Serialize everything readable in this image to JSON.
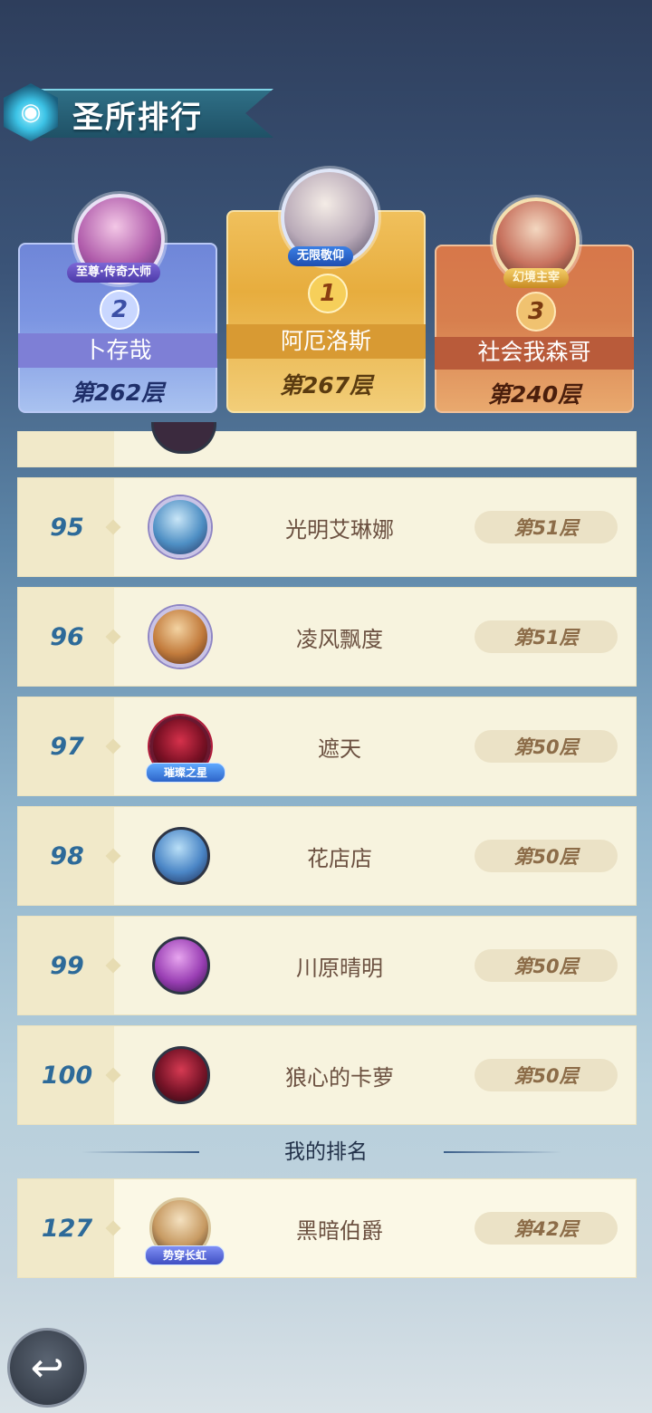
{
  "header": {
    "title": "圣所排行",
    "icon": "sanctuary-emblem-icon"
  },
  "podium": [
    {
      "rank": "2",
      "name": "卜存哉",
      "floor": "第262层",
      "title": "至尊·传奇大师"
    },
    {
      "rank": "1",
      "name": "阿厄洛斯",
      "floor": "第267层",
      "title": "无限敬仰"
    },
    {
      "rank": "3",
      "name": "社会我森哥",
      "floor": "第240层",
      "title": "幻境主宰"
    }
  ],
  "list": [
    {
      "rank": "95",
      "name": "光明艾琳娜",
      "floor": "第51层"
    },
    {
      "rank": "96",
      "name": "凌风飘度",
      "floor": "第51层"
    },
    {
      "rank": "97",
      "name": "遮天",
      "floor": "第50层",
      "badge": "璀璨之星"
    },
    {
      "rank": "98",
      "name": "花店店",
      "floor": "第50层"
    },
    {
      "rank": "99",
      "name": "川原晴明",
      "floor": "第50层"
    },
    {
      "rank": "100",
      "name": "狼心的卡萝",
      "floor": "第50层"
    }
  ],
  "my_rank": {
    "label": "我的排名",
    "rank": "127",
    "name": "黑暗伯爵",
    "floor": "第42层",
    "badge": "势穿长虹"
  },
  "back_button": {
    "icon": "back-arrow-icon"
  }
}
